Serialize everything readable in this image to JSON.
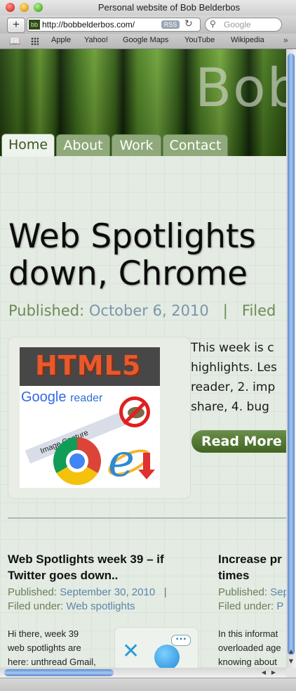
{
  "window": {
    "title": "Personal website of Bob Belderbos"
  },
  "toolbar": {
    "add_label": "+",
    "url": "http://bobbelderbos.com/",
    "favicon_text": "bb",
    "rss_label": "RSS",
    "reload_icon": "reload-icon",
    "search_placeholder": "Google"
  },
  "bookmarks": {
    "items": [
      "Apple",
      "Yahoo!",
      "Google Maps",
      "YouTube",
      "Wikipedia"
    ],
    "more": "»"
  },
  "site": {
    "name": "Bob",
    "nav": [
      {
        "label": "Home",
        "active": true
      },
      {
        "label": "About",
        "active": false
      },
      {
        "label": "Work",
        "active": false
      },
      {
        "label": "Contact",
        "active": false
      }
    ]
  },
  "featured": {
    "title_line1": "Web Spotlights",
    "title_line2": "down, Chrome",
    "published_label": "Published:",
    "published_date": "October 6, 2010",
    "separator": "|",
    "filed_label": "Filed",
    "image_texts": {
      "html5": "HTML5",
      "google": "Google",
      "reader": "reader",
      "image_capture": "Image Capture"
    },
    "excerpt": [
      "This week is c",
      "highlights. Les",
      "reader, 2. imp",
      "share, 4. bug"
    ],
    "read_more": "Read More »"
  },
  "posts": [
    {
      "title_line1": "Web Spotlights week 39 – if",
      "title_line2": "Twitter goes down..",
      "published_label": "Published:",
      "published_date": "September 30, 2010",
      "separator": "|",
      "filed_label": "Filed under:",
      "filed_value": "Web spotlights",
      "excerpt": [
        "Hi there, week 39",
        "web spotlights are",
        "here: unthread Gmail,"
      ]
    },
    {
      "title_line1": "Increase pr",
      "title_line2": "times",
      "published_label": "Published:",
      "published_date": "Sep",
      "filed_label": "Filed under:",
      "filed_value": "P",
      "excerpt": [
        "In this informat",
        "overloaded age",
        "knowing about"
      ]
    }
  ],
  "colors": {
    "accent_green": "#6d8a58",
    "link_blue": "#7b95aa",
    "tab_bg": "#8fa97a",
    "read_more_bg": "#4f7530",
    "scroll_blue": "#5a8bd0"
  }
}
